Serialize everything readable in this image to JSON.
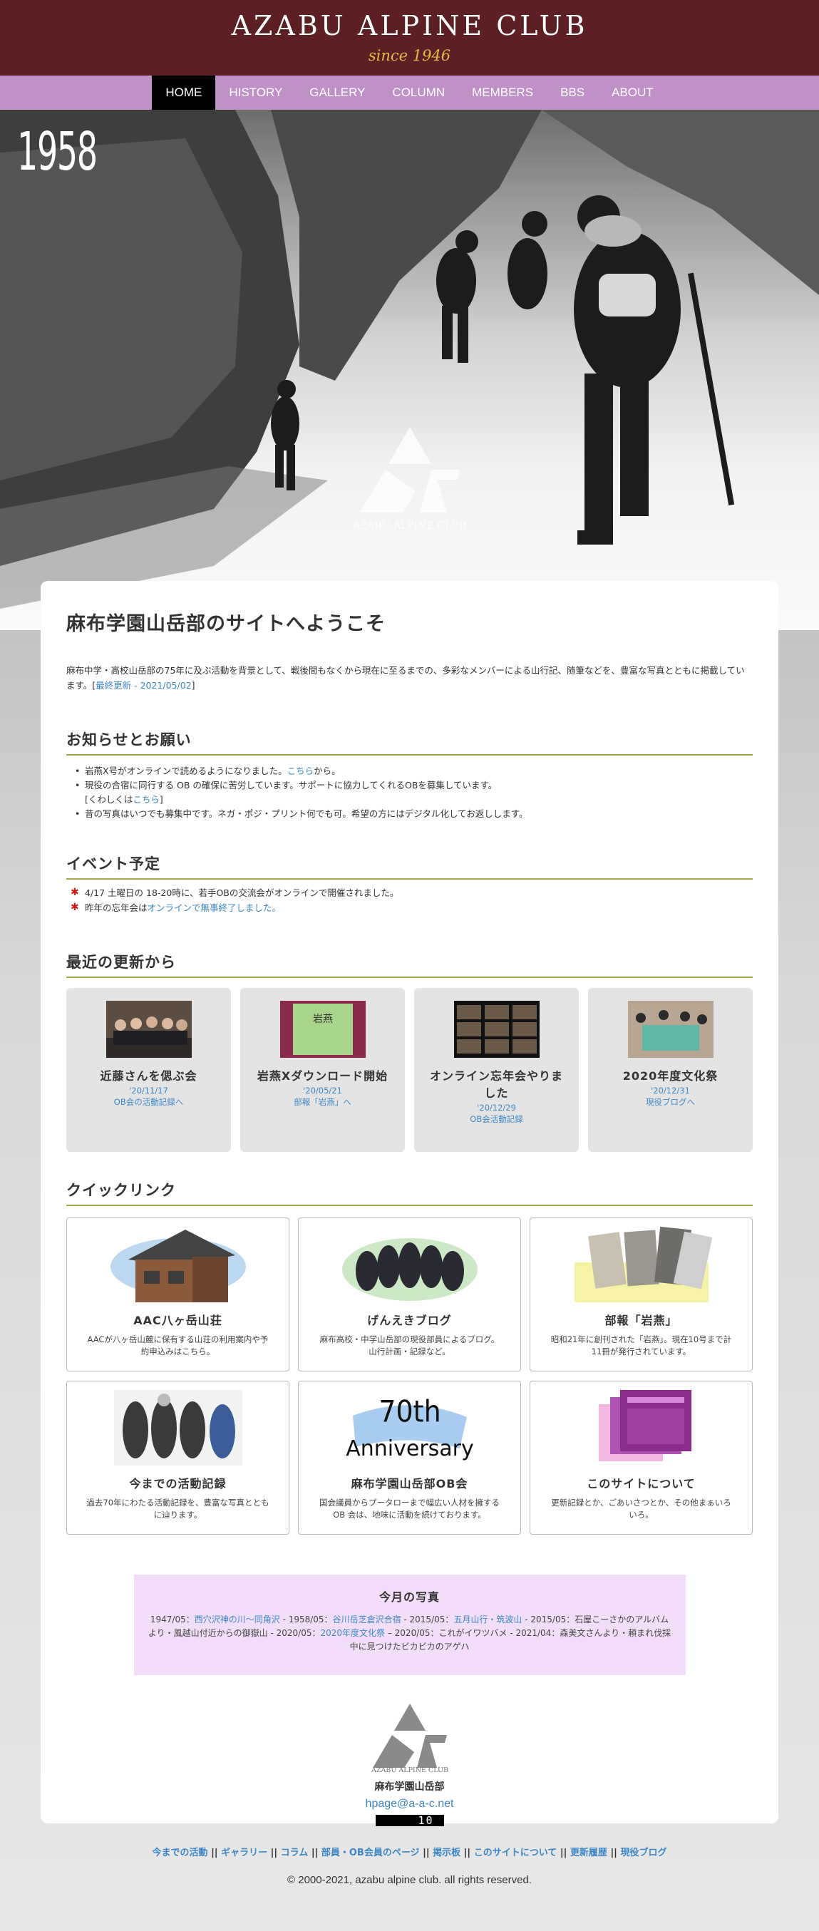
{
  "header": {
    "title": "AZABU ALPINE CLUB",
    "since": "since 1946"
  },
  "nav": [
    "HOME",
    "HISTORY",
    "GALLERY",
    "COLUMN",
    "MEMBERS",
    "BBS",
    "ABOUT"
  ],
  "hero": {
    "year": "1958",
    "watermark": "AZABU ALPINE CLUB"
  },
  "welcome": {
    "title": "麻布学園山岳部のサイトへようこそ",
    "text": "麻布中学・高校山岳部の75年に及ぶ活動を背景として、戦後間もなくから現在に至るまでの、多彩なメンバーによる山行記、随筆などを、豊富な写真とともに掲載しています。[",
    "link": "最終更新 - 2021/05/02",
    "close": "]"
  },
  "news": {
    "heading": "お知らせとお願い",
    "items": [
      {
        "pre": "岩燕X号がオンラインで読めるようになりました。",
        "link": "こちら",
        "post": "から。"
      },
      {
        "pre": "現役の合宿に同行する OB の確保に苦労しています。サポートに協力してくれるOBを募集しています。",
        "link2pre": "[くわしくは",
        "link": "こちら",
        "post": "]"
      },
      {
        "pre": "昔の写真はいつでも募集中です。ネガ・ポジ・プリント何でも可。希望の方にはデジタル化してお返しします。"
      }
    ]
  },
  "events": {
    "heading": "イベント予定",
    "items": [
      {
        "pre": "4/17 土曜日の 18-20時に、若手OBの交流会がオンラインで開催されました。"
      },
      {
        "pre": "昨年の忘年会は",
        "link": "オンラインで無事終了しました。"
      }
    ]
  },
  "updates": {
    "heading": "最近の更新から",
    "items": [
      {
        "title": "近藤さんを偲ぶ会",
        "date": "'20/11/17",
        "sub": "OB会の活動記録へ"
      },
      {
        "title": "岩燕Xダウンロード開始",
        "date": "'20/05/21",
        "sub": "部報「岩燕」へ"
      },
      {
        "title": "オンライン忘年会やりました",
        "date": "'20/12/29",
        "sub": "OB会活動記録"
      },
      {
        "title": "2020年度文化祭",
        "date": "'20/12/31",
        "sub": "現役ブログへ"
      }
    ]
  },
  "quick": {
    "heading": "クイックリンク",
    "items": [
      {
        "title": "AAC八ヶ岳山荘",
        "desc": "AACが八ヶ岳山麓に保有する山荘の利用案内や予約申込みはこちら。"
      },
      {
        "title": "げんえきブログ",
        "desc": "麻布高校・中学山岳部の現役部員によるブログ。山行計画・記録など。"
      },
      {
        "title": "部報「岩燕」",
        "desc": "昭和21年に創刊された「岩燕」。現在10号まで計11冊が発行されています。"
      },
      {
        "title": "今までの活動記録",
        "desc": "過去70年にわたる活動記録を、豊富な写真とともに辿ります。"
      },
      {
        "title": "麻布学園山岳部OB会",
        "desc": "国会議員からプータローまで幅広い人材を擁するOB 会は、地味に活動を続けております。",
        "badge1": "70th",
        "badge2": "Anniversary"
      },
      {
        "title": "このサイトについて",
        "desc": "更新記録とか、ごあいさつとか、その他まぁいろいろ。"
      }
    ]
  },
  "photo": {
    "title": "今月の写真",
    "p1": "1947/05：",
    "l1": "西穴沢神の川～同角沢",
    "p2": " - 1958/05：",
    "l2": "谷川岳芝倉沢合宿",
    "p3": " - 2015/05：",
    "l3": "五月山行・筑波山",
    "p4": " - 2015/05：石屋こーさかのアルバムより・風越山付近からの御嶽山 - 2020/05：",
    "l4": "2020年度文化祭",
    "p5": " – 2020/05：これがイワツバメ - 2021/04：森美文さんより・頼まれ伐採中に見つけたビカビカのアゲハ"
  },
  "footer": {
    "logo_text": "AZABU ALPINE CLUB",
    "name": "麻布学園山岳部",
    "mail": "hpage@a-a-c.net",
    "counter": "10",
    "links": [
      "今までの活動",
      "ギャラリー",
      "コラム",
      "部員・OB会員のページ",
      "掲示板",
      "このサイトについて",
      "更新履歴",
      "現役ブログ"
    ],
    "sep": "||",
    "copyright": "© 2000-2021, azabu alpine club. all rights reserved."
  }
}
